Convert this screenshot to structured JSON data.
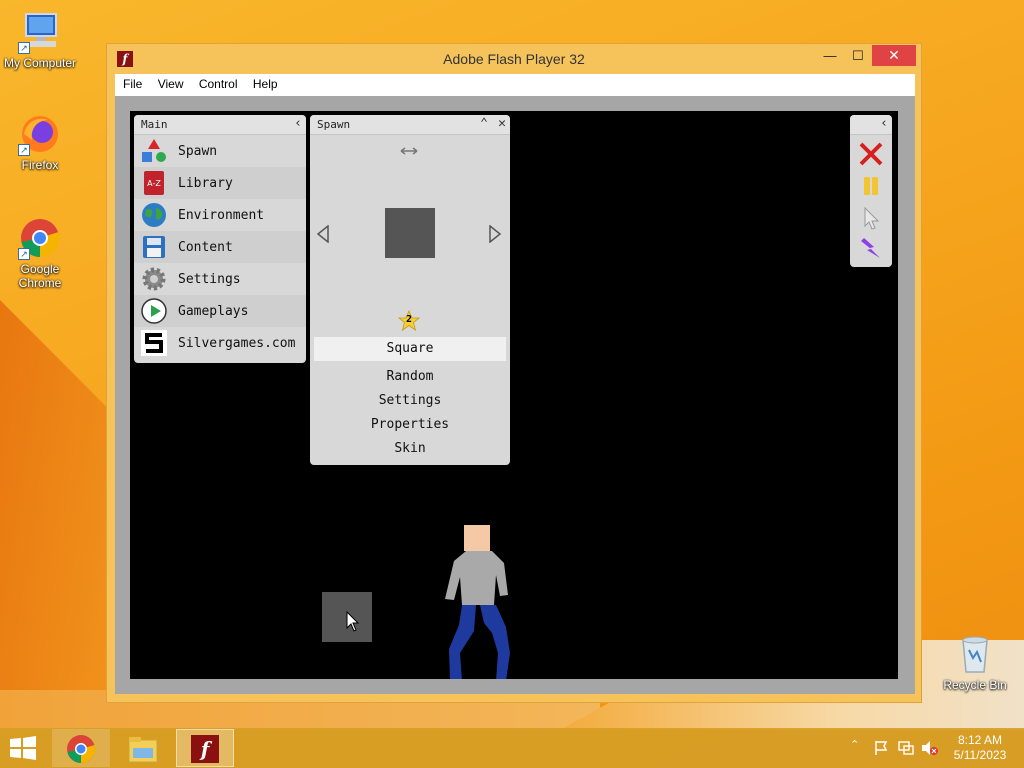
{
  "desktop": {
    "icons": [
      {
        "label": "My Computer",
        "icon": "computer-icon"
      },
      {
        "label": "Firefox",
        "icon": "firefox-icon"
      },
      {
        "label": "Google Chrome",
        "icon": "chrome-icon"
      },
      {
        "label": "Recycle Bin",
        "icon": "recycle-bin-icon"
      }
    ]
  },
  "window": {
    "title": "Adobe Flash Player 32",
    "minimize": "—",
    "maximize": "☐",
    "close": "✕",
    "menu": [
      "File",
      "View",
      "Control",
      "Help"
    ]
  },
  "game": {
    "main_panel": {
      "title": "Main",
      "collapse": "‹",
      "items": [
        {
          "label": "Spawn",
          "icon": "shapes-icon"
        },
        {
          "label": "Library",
          "icon": "library-icon",
          "badge": "A-Z"
        },
        {
          "label": "Environment",
          "icon": "globe-icon"
        },
        {
          "label": "Content",
          "icon": "floppy-disk-icon"
        },
        {
          "label": "Settings",
          "icon": "gear-icon"
        },
        {
          "label": "Gameplays",
          "icon": "play-icon"
        },
        {
          "label": "Silvergames.com",
          "icon": "silvergames-logo-icon"
        }
      ]
    },
    "spawn_panel": {
      "title": "Spawn",
      "collapse": "⌃",
      "close": "✕",
      "star_count": "2",
      "selected": "Square",
      "options": [
        "Random",
        "Settings",
        "Properties",
        "Skin"
      ]
    },
    "tools": [
      "close-tool-icon",
      "pause-icon",
      "pointer-icon",
      "lightning-icon"
    ],
    "tools_collapse": "‹",
    "colors": {
      "stage": "#000000",
      "square": "#555555",
      "shirt": "#a9a9a9",
      "pants": "#1f3a9e",
      "skin": "#f5c8a6"
    }
  },
  "taskbar": {
    "time": "8:12 AM",
    "date": "5/11/2023",
    "tray_chevron": "⌃"
  }
}
